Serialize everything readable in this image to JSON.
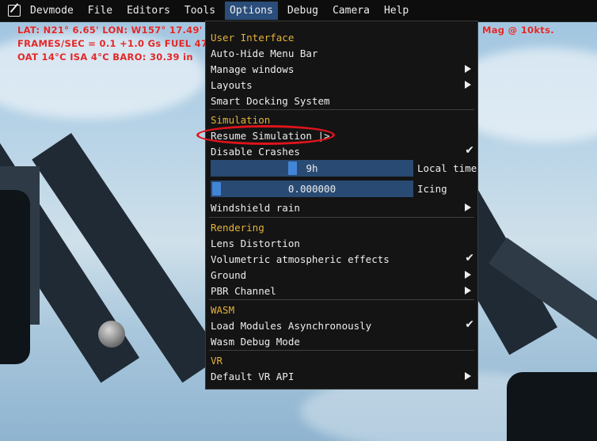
{
  "menubar": {
    "items": [
      "Devmode",
      "File",
      "Editors",
      "Tools",
      "Options",
      "Debug",
      "Camera",
      "Help"
    ],
    "active_item": "Options"
  },
  "hud": {
    "line1": "LAT: N21° 6.65'   LON: W157° 17.49'",
    "line2": "FRAMES/SEC = 0.1   +1.0 Gs   FUEL 47",
    "line3": "OAT 14°C   ISA 4°C   BARO: 30.39 in",
    "right_text": "Mag @ 10kts."
  },
  "options_menu": {
    "user_interface_header": "User Interface",
    "auto_hide_menu_bar": "Auto-Hide Menu Bar",
    "manage_windows": "Manage windows",
    "layouts": "Layouts",
    "smart_docking_system": "Smart Docking System",
    "simulation_header": "Simulation",
    "resume_simulation": "Resume Simulation |>",
    "disable_crashes": "Disable Crashes",
    "local_time_value": "9h",
    "local_time_label": "Local time",
    "local_time_fraction": 0.4,
    "icing_value": "0.000000",
    "icing_label": "Icing",
    "icing_fraction": 0.0,
    "windshield_rain": "Windshield rain",
    "rendering_header": "Rendering",
    "lens_distortion": "Lens Distortion",
    "volumetric_atmospheric_effects": "Volumetric atmospheric effects",
    "ground": "Ground",
    "pbr_channel": "PBR Channel",
    "wasm_header": "WASM",
    "load_modules_async": "Load Modules Asynchronously",
    "wasm_debug_mode": "Wasm Debug Mode",
    "vr_header": "VR",
    "default_vr_api": "Default VR API",
    "check_glyph": "✔"
  },
  "colors": {
    "header": "#e3b23c",
    "active_menu": "#2a4d7a",
    "slider_track": "#294a73",
    "slider_grab": "#4285d6",
    "hud_text": "#e22727",
    "annotation": "#e0141c"
  }
}
